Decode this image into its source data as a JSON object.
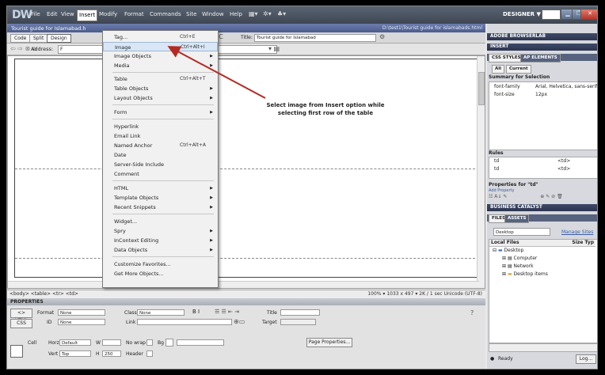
{
  "app": {
    "logo": "DW",
    "menu": [
      "File",
      "Edit",
      "View",
      "Insert",
      "Modify",
      "Format",
      "Commands",
      "Site",
      "Window",
      "Help"
    ],
    "workspace": "DESIGNER ▼"
  },
  "document": {
    "tab_name": "Tourist guide for Islamabad.h",
    "path": "D:\\test1\\Tourist guide for islamabads.html",
    "view_buttons": [
      "Code",
      "Split",
      "Design"
    ],
    "title_label": "Title:",
    "title_value": "Tourist guide for Islamabad",
    "address_label": "Address:",
    "address_value": "F"
  },
  "annotation": {
    "line1": "Select image from Insert option while",
    "line2": "selecting first row of the table"
  },
  "insert_menu": {
    "items": [
      {
        "label": "Tag...",
        "shortcut": "Ctrl+E",
        "submenu": false
      },
      {
        "label": "Image",
        "shortcut": "Ctrl+Alt+I",
        "submenu": false,
        "highlighted": true
      },
      {
        "label": "Image Objects",
        "shortcut": "",
        "submenu": true
      },
      {
        "label": "Media",
        "shortcut": "",
        "submenu": true
      },
      {
        "label": "Table",
        "shortcut": "Ctrl+Alt+T",
        "submenu": false
      },
      {
        "label": "Table Objects",
        "shortcut": "",
        "submenu": true
      },
      {
        "label": "Layout Objects",
        "shortcut": "",
        "submenu": true
      },
      {
        "label": "Form",
        "shortcut": "",
        "submenu": true
      },
      {
        "label": "Hyperlink",
        "shortcut": "",
        "submenu": false
      },
      {
        "label": "Email Link",
        "shortcut": "",
        "submenu": false
      },
      {
        "label": "Named Anchor",
        "shortcut": "Ctrl+Alt+A",
        "submenu": false
      },
      {
        "label": "Date",
        "shortcut": "",
        "submenu": false
      },
      {
        "label": "Server-Side Include",
        "shortcut": "",
        "submenu": false
      },
      {
        "label": "Comment",
        "shortcut": "",
        "submenu": false
      },
      {
        "label": "HTML",
        "shortcut": "",
        "submenu": true
      },
      {
        "label": "Template Objects",
        "shortcut": "",
        "submenu": true
      },
      {
        "label": "Recent Snippets",
        "shortcut": "",
        "submenu": true
      },
      {
        "label": "Widget...",
        "shortcut": "",
        "submenu": false
      },
      {
        "label": "Spry",
        "shortcut": "",
        "submenu": true
      },
      {
        "label": "InContext Editing",
        "shortcut": "",
        "submenu": true
      },
      {
        "label": "Data Objects",
        "shortcut": "",
        "submenu": true
      },
      {
        "label": "Customize Favorites...",
        "shortcut": "",
        "submenu": false
      },
      {
        "label": "Get More Objects...",
        "shortcut": "",
        "submenu": false
      }
    ]
  },
  "status": {
    "tag_path": "<body> <table> <tr> <td>",
    "right": "100%  ▾  1033 x 497 ▾  2K / 1 sec  Unicode (UTF-8)"
  },
  "properties": {
    "header": "PROPERTIES",
    "html_btn": "<> HTML",
    "css_btn": "CSS",
    "format_label": "Format",
    "format_value": "None",
    "class_label": "Class",
    "class_value": "None",
    "id_label": "ID",
    "id_value": "None",
    "link_label": "Link",
    "title_label": "Title",
    "target_label": "Target",
    "cell_label": "Cell",
    "horz_label": "Horz",
    "horz_value": "Default",
    "vert_label": "Vert",
    "vert_value": "Top",
    "w_label": "W",
    "h_label": "H",
    "h_value": "250",
    "nowrap_label": "No wrap",
    "header_label": "Header",
    "bg_label": "Bg",
    "page_props": "Page Properties..."
  },
  "right_panel": {
    "browserlab": "ADOBE BROWSERLAB",
    "insert": "INSERT",
    "css_tab": "CSS STYLES",
    "ap_tab": "AP ELEMENTS",
    "all_tab": "All",
    "current_tab": "Current",
    "summary_title": "Summary for Selection",
    "summary": [
      {
        "prop": "font-family",
        "value": "Arial, Helvetica, sans-serif"
      },
      {
        "prop": "font-size",
        "value": "12px"
      }
    ],
    "rules_title": "Rules",
    "rules": [
      {
        "sel": "td",
        "tag": "<td>"
      },
      {
        "sel": "td",
        "tag": "<td>"
      }
    ],
    "props_for": "Properties for \"td\"",
    "add_property": "Add Property",
    "business_catalyst": "BUSINESS CATALYST",
    "files_tab": "FILES",
    "assets_tab": "ASSETS",
    "desktop_select": "Desktop",
    "manage_sites": "Manage Sites",
    "local_files": "Local Files",
    "size_typ": "Size  Typ",
    "tree": [
      "Desktop",
      "Computer",
      "Network",
      "Desktop items"
    ],
    "ready": "Ready",
    "log": "Log..."
  }
}
